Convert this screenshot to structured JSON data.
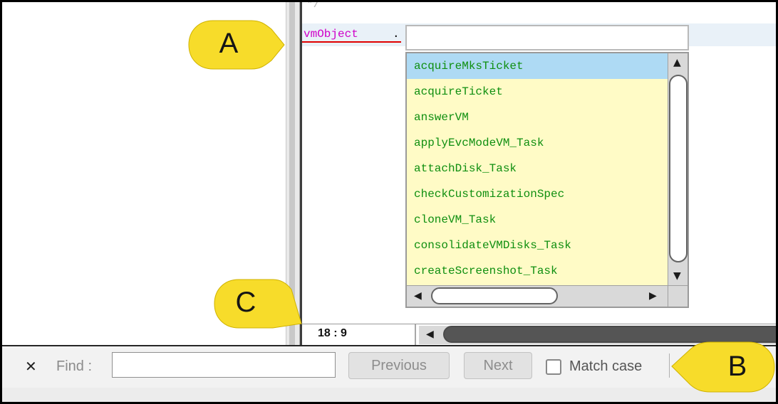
{
  "editor": {
    "previous_line_fragment": "*/",
    "code_object": "vmObject",
    "code_dot": ".",
    "cursor_position": "18 : 9"
  },
  "autocomplete": {
    "input_value": "",
    "items": [
      "acquireMksTicket",
      "acquireTicket",
      "answerVM",
      "applyEvcModeVM_Task",
      "attachDisk_Task",
      "checkCustomizationSpec",
      "cloneVM_Task",
      "consolidateVMDisks_Task",
      "createScreenshot_Task"
    ],
    "selected_index": 0
  },
  "find_bar": {
    "close_glyph": "✕",
    "find_label": "Find :",
    "find_input_value": "",
    "previous_label": "Previous",
    "next_label": "Next",
    "match_case_label": "Match case",
    "match_case_checked": false
  },
  "callouts": {
    "a": "A",
    "b": "B",
    "c": "C",
    "color": "#f7dc2a"
  },
  "icons": {
    "scroll_up": "▲",
    "scroll_down": "▼",
    "scroll_left": "◀",
    "scroll_right": "▶"
  }
}
